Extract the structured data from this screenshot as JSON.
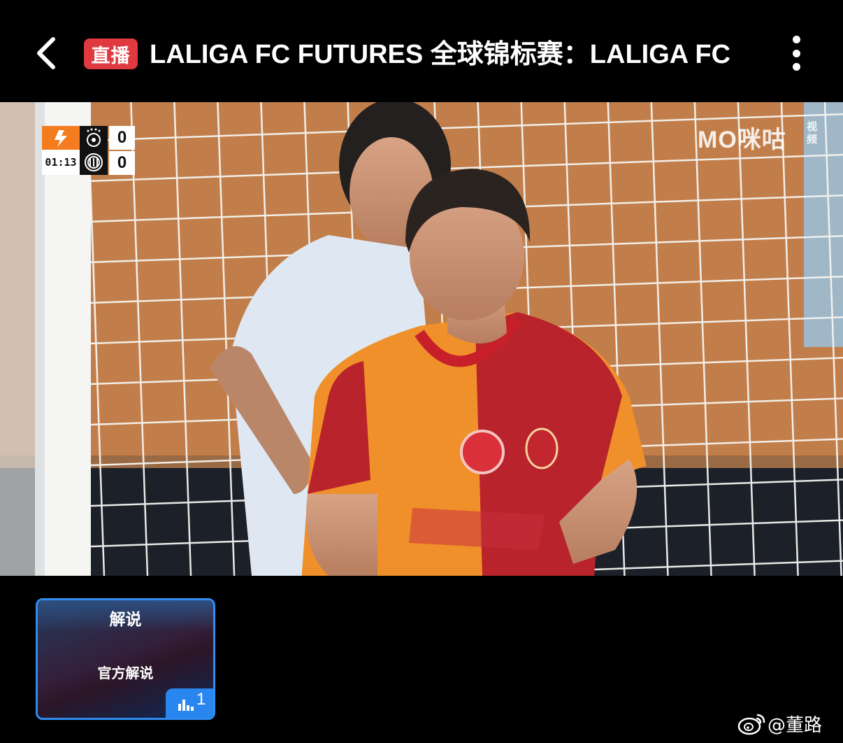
{
  "header": {
    "live_label": "直播",
    "title": "LALIGA FC FUTURES 全球锦标赛：LALIGA FC",
    "back_icon": "chevron-left-icon",
    "more_icon": "vertical-ellipsis-icon"
  },
  "scoreboard": {
    "time": "01:13",
    "home_score": "0",
    "away_score": "0"
  },
  "watermark": {
    "logo_text": "ΜΟ咪咕",
    "logo_sub": "视频"
  },
  "commentary": {
    "title": "解说",
    "option": "官方解说",
    "count": "1"
  },
  "footer": {
    "credit": "@董路"
  },
  "colors": {
    "live_red": "#e0393f",
    "card_border": "#2f8cf0",
    "laliga_orange": "#f47c1f"
  }
}
